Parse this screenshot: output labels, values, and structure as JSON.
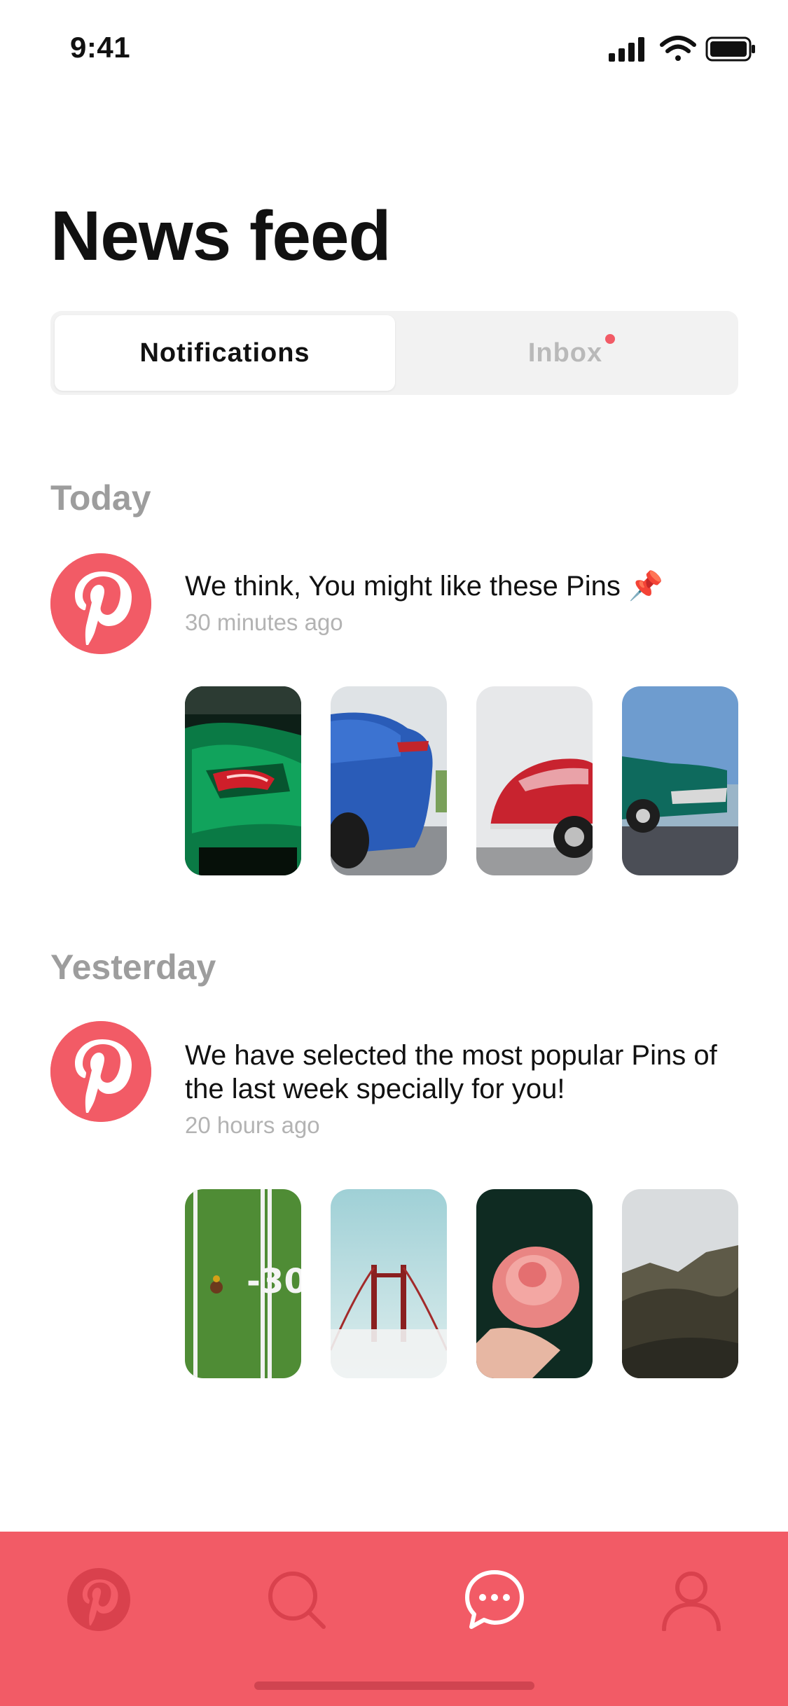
{
  "status_bar": {
    "time": "9:41"
  },
  "header": {
    "title": "News feed"
  },
  "tabs": {
    "notifications_label": "Notifications",
    "inbox_label": "Inbox",
    "inbox_unread": true,
    "active": "Notifications"
  },
  "sections": [
    {
      "label": "Today",
      "notification": {
        "message": "We think, You might like these Pins 📌",
        "time": "30 minutes ago",
        "avatar_icon": "pinterest-logo-icon"
      },
      "pins": [
        "green-sports-car",
        "blue-car-rear",
        "red-classic-car",
        "teal-vintage-car"
      ]
    },
    {
      "label": "Yesterday",
      "notification": {
        "message": "We have selected the most popular Pins of the last week specially for you!",
        "time": "20 hours ago",
        "avatar_icon": "pinterest-logo-icon"
      },
      "pins": [
        "football-field",
        "golden-gate-bridge-fog",
        "pink-rose",
        "mountain-valley"
      ]
    }
  ],
  "bottom_nav": {
    "items": [
      "home-icon",
      "search-icon",
      "messages-icon",
      "profile-icon"
    ],
    "active": "messages-icon"
  },
  "colors": {
    "accent": "#f25b66",
    "tab_inactive_icon": "#d9414d",
    "tab_active_icon": "#ffffff",
    "section_header": "#9d9d9d",
    "timestamp": "#b3b3b3"
  }
}
